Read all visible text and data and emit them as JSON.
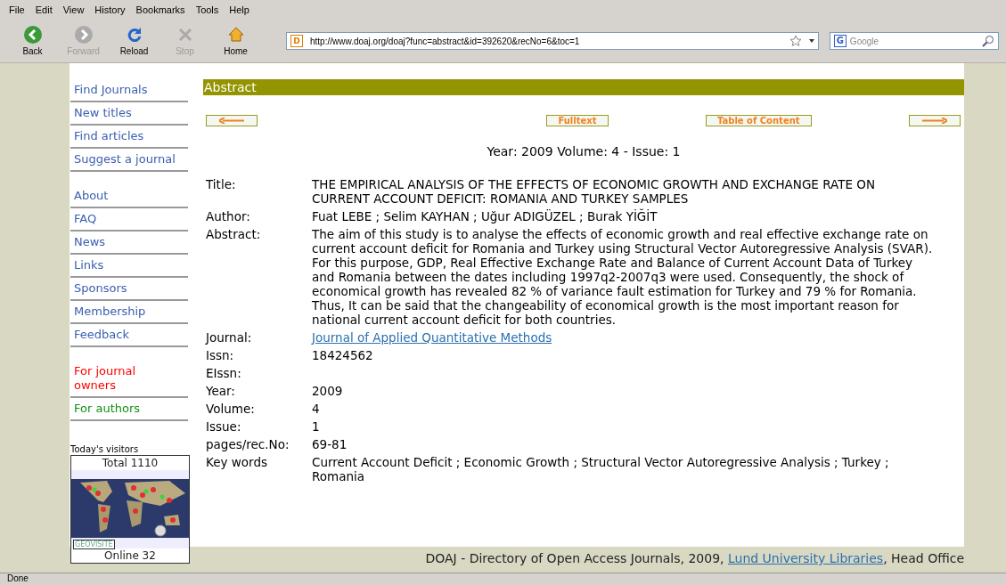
{
  "browser": {
    "menu": [
      "File",
      "Edit",
      "View",
      "History",
      "Bookmarks",
      "Tools",
      "Help"
    ],
    "toolbar": [
      {
        "label": "Back",
        "kind": "back",
        "disabled": false
      },
      {
        "label": "Forward",
        "kind": "forward",
        "disabled": true
      },
      {
        "label": "Reload",
        "kind": "reload",
        "disabled": false
      },
      {
        "label": "Stop",
        "kind": "stop",
        "disabled": true
      },
      {
        "label": "Home",
        "kind": "home",
        "disabled": false
      }
    ],
    "site_icon": "D",
    "search_engine_icon": "G",
    "url": "http://www.doaj.org/doaj?func=abstract&id=392620&recNo=6&toc=1",
    "search": {
      "placeholder": "Google"
    },
    "status": "Done"
  },
  "sidebar": {
    "groups": [
      [
        {
          "label": "Find Journals",
          "kind": "link"
        },
        {
          "label": "New titles",
          "kind": "link"
        },
        {
          "label": "Find articles",
          "kind": "link"
        },
        {
          "label": "Suggest a journal",
          "kind": "link"
        }
      ],
      [
        {
          "label": "About",
          "kind": "link"
        },
        {
          "label": "FAQ",
          "kind": "link"
        },
        {
          "label": "News",
          "kind": "link"
        },
        {
          "label": "Links",
          "kind": "link"
        },
        {
          "label": "Sponsors",
          "kind": "link"
        },
        {
          "label": "Membership",
          "kind": "link"
        },
        {
          "label": "Feedback",
          "kind": "link"
        }
      ],
      [
        {
          "label": "For journal owners",
          "kind": "owners"
        },
        {
          "label": "For authors",
          "kind": "authors"
        }
      ]
    ],
    "visitors": {
      "caption": "Today's visitors",
      "total": "Total 1110",
      "online": "Online 32",
      "badge": "GEOVISITE"
    }
  },
  "main": {
    "section_title": "Abstract",
    "nav": [
      {
        "kind": "prev"
      },
      {
        "kind": "text",
        "label": "Fulltext"
      },
      {
        "kind": "text",
        "label": "Table of Content"
      },
      {
        "kind": "next"
      }
    ],
    "issue_line": "Year: 2009 Volume: 4 - Issue: 1",
    "fields": [
      {
        "label": "Title:",
        "value": "THE EMPIRICAL ANALYSIS OF THE EFFECTS OF ECONOMIC GROWTH AND EXCHANGE RATE ON CURRENT ACCOUNT DEFICIT: ROMANIA AND TURKEY SAMPLES",
        "kind": "text"
      },
      {
        "label": "Author:",
        "value": "Fuat LEBE ; Selim KAYHAN ; Uğur ADIGÜZEL ; Burak YİĞİT",
        "kind": "text"
      },
      {
        "label": "Abstract:",
        "value": "The aim of this study is to analyse the effects of economic growth and real effective exchange rate on current account deficit for Romania and Turkey using Structural Vector Autoregressive Analysis (SVAR). For this purpose, GDP, Real Effective Exchange Rate and Balance of Current Account Data of Turkey and Romania between the dates including 1997q2-2007q3 were used. Consequently, the shock of economical growth has revealed 82 % of variance fault estimation for Turkey and 79 % for Romania. Thus, It can be said that the changeability of economical growth is the most important reason for national current account deficit for both countries.",
        "kind": "text"
      },
      {
        "label": "Journal:",
        "value": "Journal of Applied Quantitative Methods",
        "kind": "link"
      },
      {
        "label": "Issn:",
        "value": "18424562",
        "kind": "text"
      },
      {
        "label": "EIssn:",
        "kind": "text"
      },
      {
        "label": "Year:",
        "value": "2009",
        "kind": "text"
      },
      {
        "label": "Volume:",
        "value": "4",
        "kind": "text"
      },
      {
        "label": "Issue:",
        "value": "1",
        "kind": "text"
      },
      {
        "label": "pages/rec.No:",
        "value": "69-81",
        "kind": "text"
      },
      {
        "label": "Key words",
        "value": "Current Account Deficit ; Economic Growth ; Structural Vector Autoregressive Analysis ; Turkey ; Romania",
        "kind": "text"
      }
    ]
  },
  "footer": {
    "text_before": "DOAJ - Directory of Open Access Journals, 2009,",
    "link": "Lund University Libraries",
    "text_after": ", Head Office"
  }
}
